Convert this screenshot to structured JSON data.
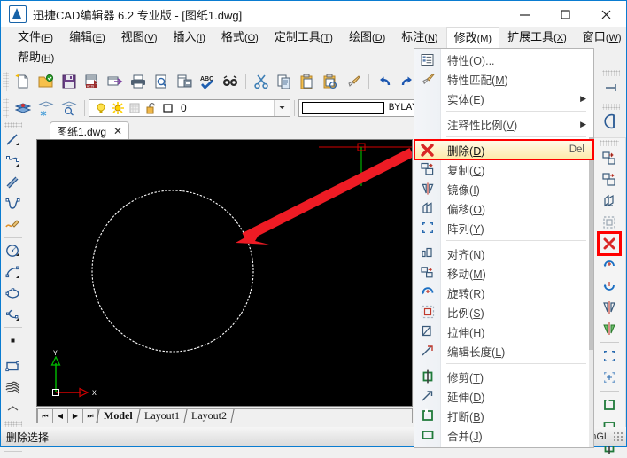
{
  "window": {
    "title": "迅捷CAD编辑器 6.2 专业版  - [图纸1.dwg]",
    "minimize": "—",
    "maximize": "□",
    "close": "✕"
  },
  "menubar": {
    "row1": [
      {
        "label": "文件",
        "key": "F"
      },
      {
        "label": "编辑",
        "key": "E"
      },
      {
        "label": "视图",
        "key": "V"
      },
      {
        "label": "插入",
        "key": "I"
      },
      {
        "label": "格式",
        "key": "O"
      },
      {
        "label": "定制工具",
        "key": "T"
      },
      {
        "label": "绘图",
        "key": "D"
      },
      {
        "label": "标注",
        "key": "N"
      },
      {
        "label": "修改",
        "key": "M",
        "active": true
      },
      {
        "label": "扩展工具",
        "key": "X"
      },
      {
        "label": "窗口",
        "key": "W"
      }
    ],
    "row2": [
      {
        "label": "帮助",
        "key": "H"
      }
    ]
  },
  "toolbar_standard": {
    "icons": [
      "new-file-icon",
      "open-file-icon",
      "save-icon",
      "save-acis-icon",
      "export-icon",
      "print-icon",
      "print-preview-icon",
      "plot-icon",
      "spell-check-icon",
      "find-icon",
      "cut-icon",
      "copy-icon",
      "paste-icon",
      "paste-special-icon",
      "match-properties-icon",
      "undo-icon",
      "redo-icon",
      "erase-icon",
      "explode-icon",
      "brush-icon"
    ],
    "highlighted": "erase-icon"
  },
  "toolbar_layer": {
    "icons": [
      "layer-manager-icon",
      "layer-freeze-icon",
      "layer-state-icon"
    ],
    "layer_state": {
      "on_icon": "lightbulb-icon",
      "thaw_icon": "sun-icon",
      "freeze_vp_icon": "freeze-viewport-icon",
      "lock_icon": "unlock-icon",
      "color_icon": "layer-color-icon",
      "name": "0"
    },
    "lineweight_value": "BYLAYER",
    "dropdown_arrow": "▼"
  },
  "left_toolbar": {
    "icons": [
      "line-icon",
      "polyline-icon",
      "double-line-icon",
      "spline-icon",
      "sketch-icon",
      "circle-icon",
      "arc-icon",
      "ellipse-icon",
      "elliptical-arc-icon",
      "point-icon",
      "rectangle-icon",
      "revision-cloud-icon",
      "collapse-icon",
      "refresh-icon"
    ]
  },
  "right_toolbar": {
    "groups": [
      {
        "icons": [
          "extend-line-icon"
        ]
      },
      {
        "icons": [
          "half-circle-icon"
        ]
      },
      {
        "icons": [
          "move-copy-icon",
          "copy-object-icon",
          "offset-icon",
          "scale-sel-icon",
          "erase-icon",
          "rotate-icon",
          "rotate-3d-icon",
          "mirror-icon",
          "mirror-3d-icon",
          "array-rect-icon",
          "array-polar-icon",
          "break-at-point-icon",
          "join-icon",
          "trim-icon"
        ]
      }
    ],
    "highlighted": "erase-icon"
  },
  "document": {
    "tab_label": "图纸1.dwg",
    "tab_close": "✕",
    "layout_nav": [
      "⏮",
      "◀",
      "▶",
      "⏭"
    ],
    "layout_tabs": [
      {
        "label": "Model",
        "selected": true
      },
      {
        "label": "Layout1",
        "selected": false
      },
      {
        "label": "Layout2",
        "selected": false
      }
    ],
    "ucs": {
      "y_label": "Y",
      "x_label": "X"
    }
  },
  "statusbar": {
    "message": "删除选择",
    "right_label": "nGL"
  },
  "modify_menu": {
    "items": [
      {
        "icon": "properties-icon",
        "label": "特性",
        "key": "O",
        "suffix": "...",
        "type": "item"
      },
      {
        "icon": "match-properties-icon",
        "label": "特性匹配",
        "key": "M",
        "suffix": "",
        "type": "item"
      },
      {
        "icon": "entity-icon",
        "label": "实体",
        "key": "E",
        "suffix": "",
        "type": "submenu",
        "arrow": "▶"
      },
      {
        "type": "separator"
      },
      {
        "icon": "annotative-scale-icon",
        "label": "注释性比例",
        "key": "V",
        "suffix": "",
        "type": "submenu",
        "arrow": "▶"
      },
      {
        "type": "separator"
      },
      {
        "icon": "erase-icon",
        "label": "删除",
        "key": "D",
        "suffix": "",
        "type": "item",
        "shortcut": "Del",
        "selected": true
      },
      {
        "icon": "copy-object-icon",
        "label": "复制",
        "key": "C",
        "suffix": "",
        "type": "item"
      },
      {
        "icon": "mirror-icon",
        "label": "镜像",
        "key": "I",
        "suffix": "",
        "type": "item"
      },
      {
        "icon": "offset-icon",
        "label": "偏移",
        "key": "O",
        "suffix": "",
        "type": "item"
      },
      {
        "icon": "array-icon",
        "label": "阵列",
        "key": "Y",
        "suffix": "",
        "type": "item"
      },
      {
        "type": "separator"
      },
      {
        "icon": "align-icon",
        "label": "对齐",
        "key": "N",
        "suffix": "",
        "type": "item"
      },
      {
        "icon": "move-icon",
        "label": "移动",
        "key": "M",
        "suffix": "",
        "type": "item"
      },
      {
        "icon": "rotate-icon",
        "label": "旋转",
        "key": "R",
        "suffix": "",
        "type": "item"
      },
      {
        "icon": "scale-icon",
        "label": "比例",
        "key": "S",
        "suffix": "",
        "type": "item"
      },
      {
        "icon": "stretch-icon",
        "label": "拉伸",
        "key": "H",
        "suffix": "",
        "type": "item"
      },
      {
        "icon": "lengthen-icon",
        "label": "编辑长度",
        "key": "L",
        "suffix": "",
        "type": "item"
      },
      {
        "type": "separator"
      },
      {
        "icon": "trim-icon",
        "label": "修剪",
        "key": "T",
        "suffix": "",
        "type": "item"
      },
      {
        "icon": "extend-icon",
        "label": "延伸",
        "key": "D",
        "suffix": "",
        "type": "item"
      },
      {
        "icon": "break-icon",
        "label": "打断",
        "key": "B",
        "suffix": "",
        "type": "item"
      },
      {
        "icon": "join-icon",
        "label": "合并",
        "key": "J",
        "suffix": "",
        "type": "item"
      }
    ]
  },
  "colors": {
    "accent": "#0a7cd1",
    "highlight_red": "#ff0000",
    "menu_select": "#fde9a8",
    "canvas_bg": "#000000",
    "circle_stroke": "#ffffff",
    "arrow": "#ee1b24",
    "crosshair_h": "#d40000",
    "crosshair_v": "#00c000"
  }
}
